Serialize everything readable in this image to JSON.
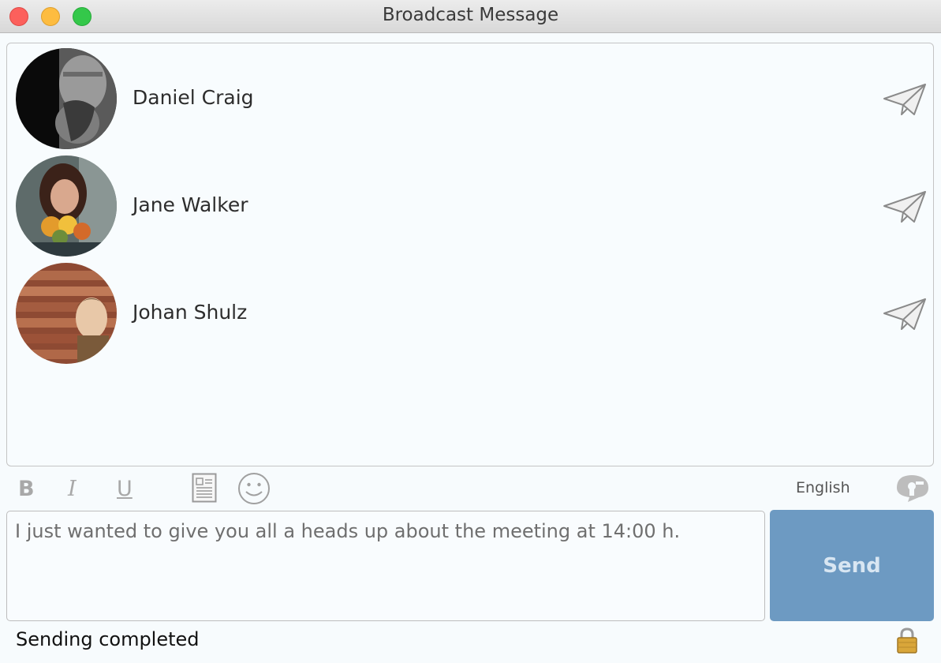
{
  "window": {
    "title": "Broadcast Message"
  },
  "recipients": [
    {
      "name": "Daniel Craig",
      "avatar": "avatar-daniel-craig",
      "send_icon": "paper-plane-icon"
    },
    {
      "name": "Jane Walker",
      "avatar": "avatar-jane-walker",
      "send_icon": "paper-plane-icon"
    },
    {
      "name": "Johan Shulz",
      "avatar": "avatar-johan-shulz",
      "send_icon": "paper-plane-icon"
    }
  ],
  "toolbar": {
    "bold": "B",
    "italic": "I",
    "underline": "U",
    "template_icon": "document-icon",
    "emoji_icon": "smiley-icon",
    "language": "English",
    "translate_icon": "speech-bubble-icon"
  },
  "composer": {
    "message": "I just wanted to give you all a heads up about the meeting at 14:00 h.",
    "send_label": "Send"
  },
  "status": {
    "text": "Sending completed",
    "lock_icon": "lock-icon"
  },
  "colors": {
    "send_button": "#6d9ac2",
    "background": "#f7fbfd",
    "close": "#fc605c",
    "minimize": "#fdbc40",
    "maximize": "#34c84a"
  }
}
